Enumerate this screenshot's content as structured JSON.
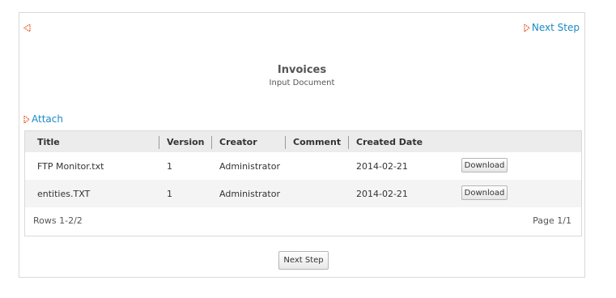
{
  "nav": {
    "next_step_label": "Next Step"
  },
  "document": {
    "title": "Invoices",
    "subtitle": "Input Document"
  },
  "attach": {
    "label": "Attach"
  },
  "table": {
    "columns": [
      "Title",
      "Version",
      "Creator",
      "Comment",
      "Created Date"
    ],
    "rows": [
      {
        "title": "FTP Monitor.txt",
        "version": "1",
        "creator": "Administrator",
        "comment": "",
        "created": "2014-02-21",
        "action": "Download"
      },
      {
        "title": "entities.TXT",
        "version": "1",
        "creator": "Administrator",
        "comment": "",
        "created": "2014-02-21",
        "action": "Download"
      }
    ],
    "rows_info": "Rows 1-2/2",
    "page_info": "Page 1/1"
  },
  "footer": {
    "next_step_button": "Next Step"
  },
  "icons": {
    "back": "back-arrow-icon",
    "next": "next-arrow-icon",
    "attach": "attach-arrow-icon"
  },
  "colors": {
    "link": "#1a8ac6",
    "arrow": "#e2551f",
    "header_bg": "#ececec"
  }
}
